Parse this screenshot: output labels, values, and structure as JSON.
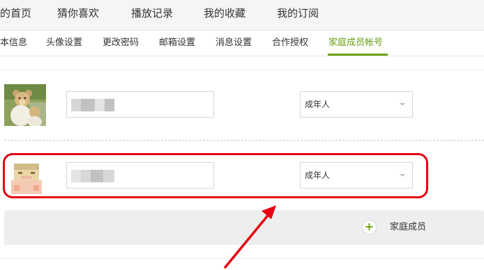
{
  "top_nav": {
    "items": [
      "的首页",
      "猜你喜欢",
      "播放记录",
      "我的收藏",
      "我的订阅"
    ]
  },
  "sub_nav": {
    "tabs": [
      "本信息",
      "头像设置",
      "更改密码",
      "邮箱设置",
      "消息设置",
      "合作授权",
      "家庭成员帐号"
    ],
    "active_tab": "家庭成员帐号"
  },
  "members": [
    {
      "avatar": "teddy-bear-avatar-icon",
      "name": "",
      "role": "成年人"
    },
    {
      "avatar": "pixel-face-avatar-icon",
      "name": "",
      "role": "成年人"
    }
  ],
  "add_member": {
    "label": "家庭成员",
    "icon": "plus-icon"
  },
  "colors": {
    "accent_green": "#6aa012",
    "highlight_red": "#e60012",
    "nav_background": "#f5f5f5"
  }
}
